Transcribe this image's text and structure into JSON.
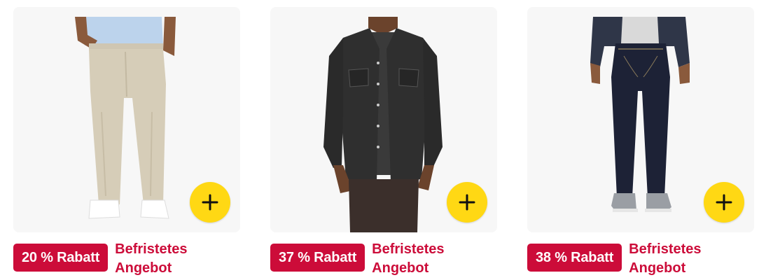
{
  "products": [
    {
      "name": "khaki-chino-pants",
      "image_icon": "khaki-pants-model-image",
      "badge": "20 % Rabatt",
      "deal_label": "Befristetes Angebot",
      "add_label": "+"
    },
    {
      "name": "black-denim-shirt",
      "image_icon": "denim-shirt-model-image",
      "badge": "37 % Rabatt",
      "deal_label": "Befristetes Angebot",
      "add_label": "+"
    },
    {
      "name": "dark-rinse-jeans",
      "image_icon": "dark-jeans-model-image",
      "badge": "38 % Rabatt",
      "deal_label": "Befristetes Angebot",
      "add_label": "+"
    }
  ],
  "colors": {
    "badge_background": "#cc0c39",
    "deal_text": "#cc0c39",
    "add_button": "#ffd814",
    "card_background": "#f7f7f7"
  }
}
